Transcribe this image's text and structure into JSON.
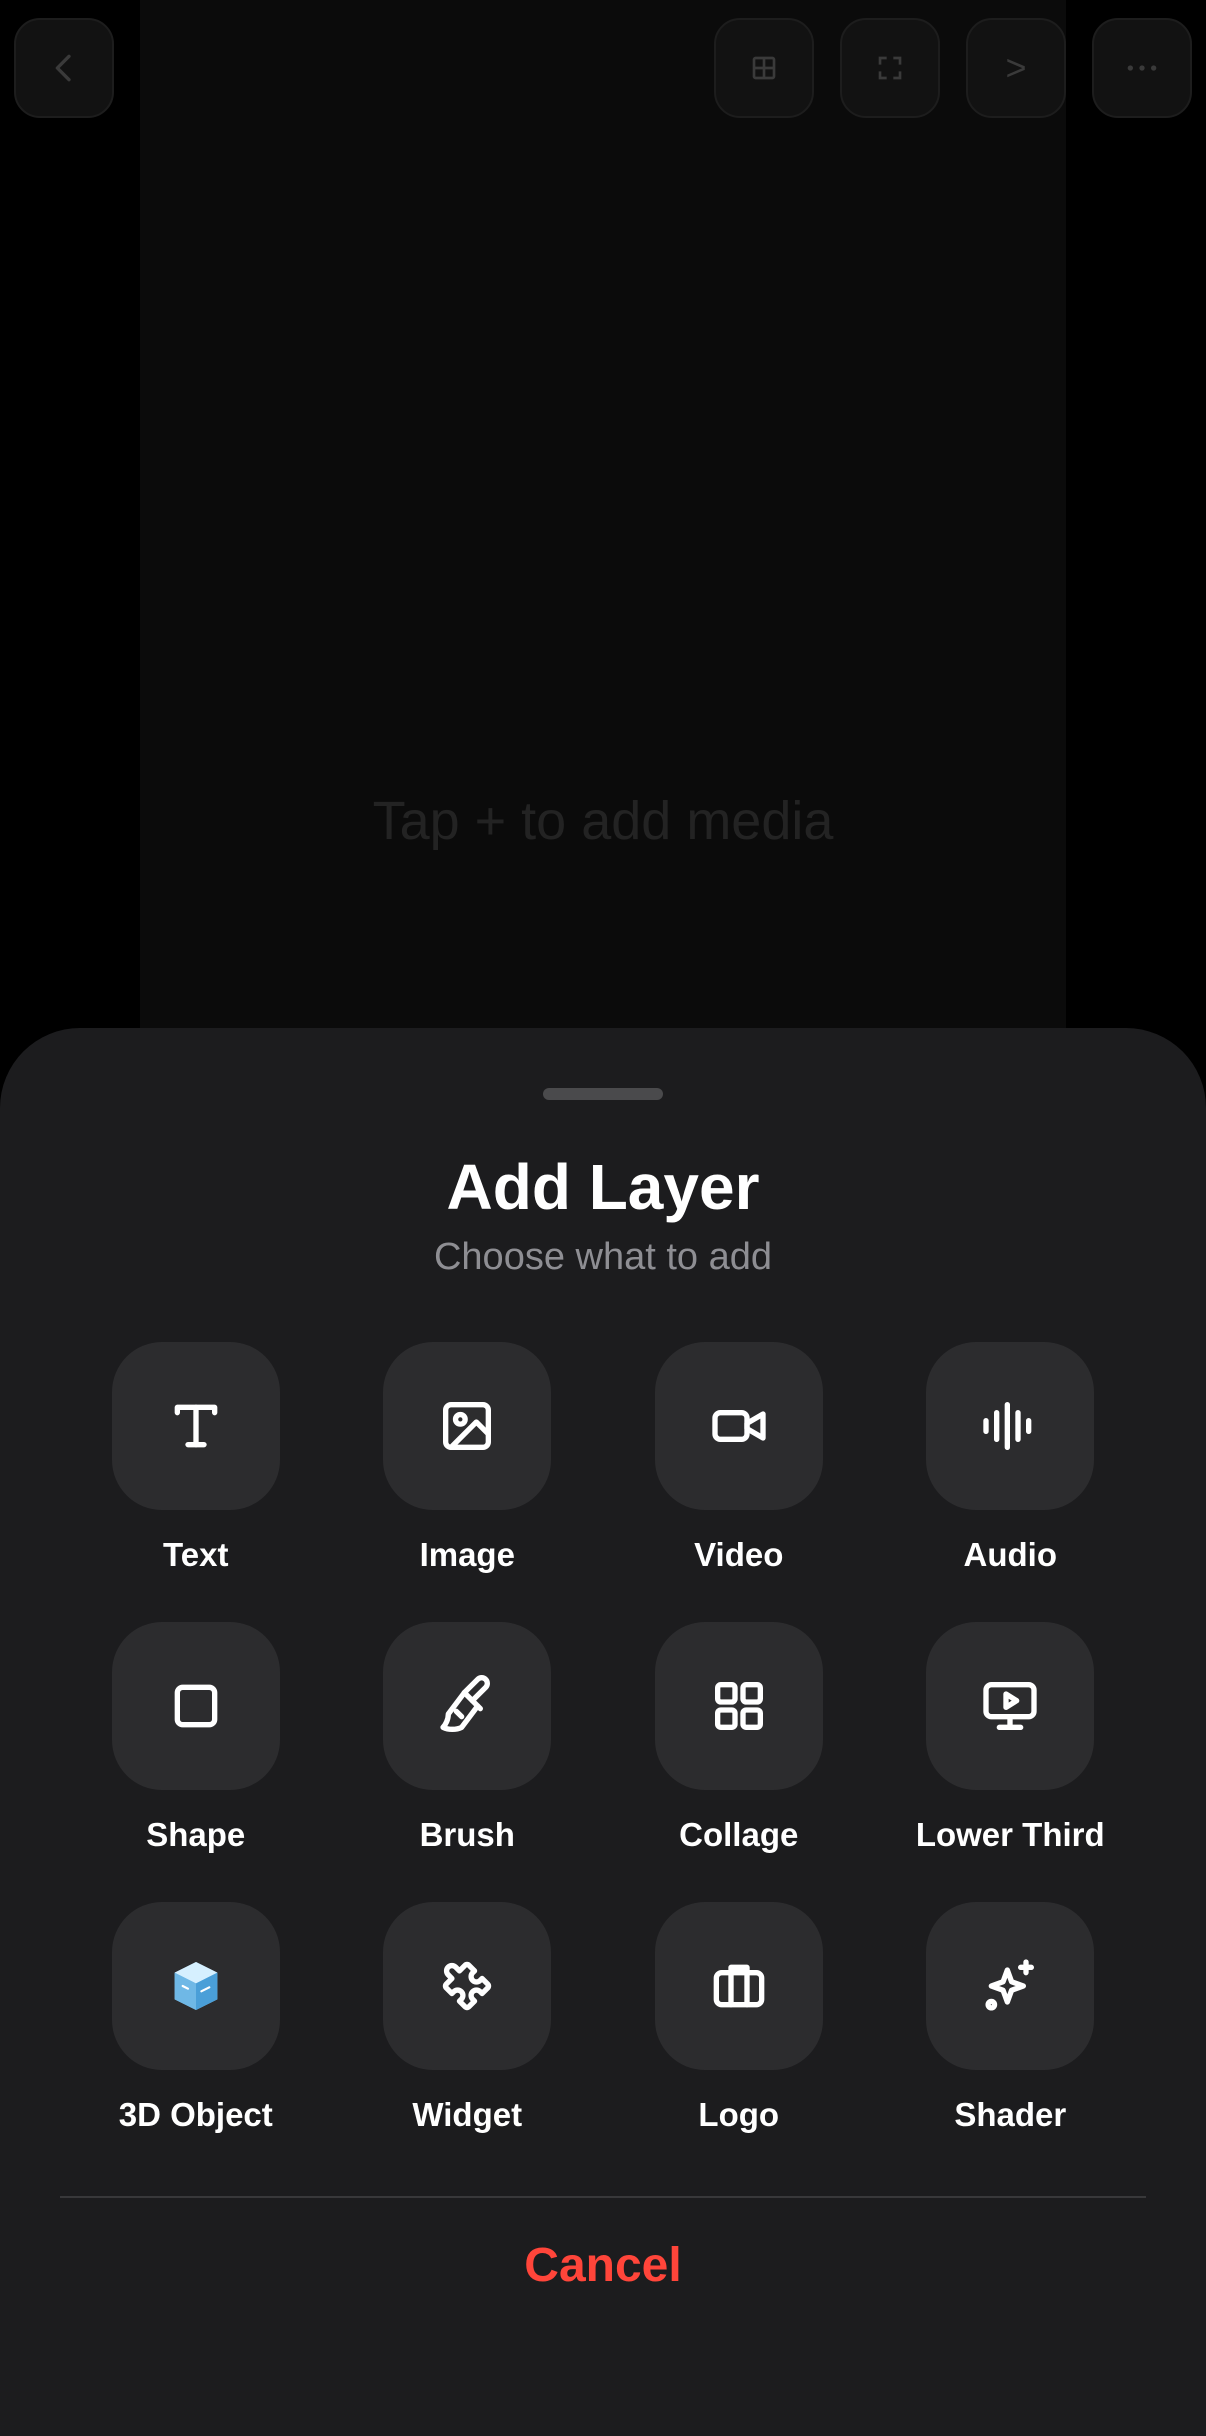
{
  "canvas": {
    "empty_hint": "Tap + to add media"
  },
  "toolbar": {
    "back_icon": "chevron-left-icon",
    "grid_icon": "grid-icon",
    "fullscreen_icon": "fullscreen-icon",
    "play_label": ">",
    "more_icon": "ellipsis-icon"
  },
  "sheet": {
    "title": "Add Layer",
    "subtitle": "Choose what to add",
    "items": [
      {
        "label": "Text",
        "icon": "text-icon"
      },
      {
        "label": "Image",
        "icon": "image-icon"
      },
      {
        "label": "Video",
        "icon": "video-icon"
      },
      {
        "label": "Audio",
        "icon": "audio-waveform-icon"
      },
      {
        "label": "Shape",
        "icon": "square-icon"
      },
      {
        "label": "Brush",
        "icon": "brush-icon"
      },
      {
        "label": "Collage",
        "icon": "grid-2x2-icon"
      },
      {
        "label": "Lower Third",
        "icon": "monitor-play-icon"
      },
      {
        "label": "3D Object",
        "icon": "ice-cube-icon"
      },
      {
        "label": "Widget",
        "icon": "puzzle-icon"
      },
      {
        "label": "Logo",
        "icon": "briefcase-icon"
      },
      {
        "label": "Shader",
        "icon": "sparkles-icon"
      }
    ],
    "cancel_label": "Cancel"
  },
  "colors": {
    "sheet_background": "#1c1c1e",
    "tile_background": "#2c2c2e",
    "cancel": "#ff453a",
    "subtitle": "#8e8e93"
  }
}
